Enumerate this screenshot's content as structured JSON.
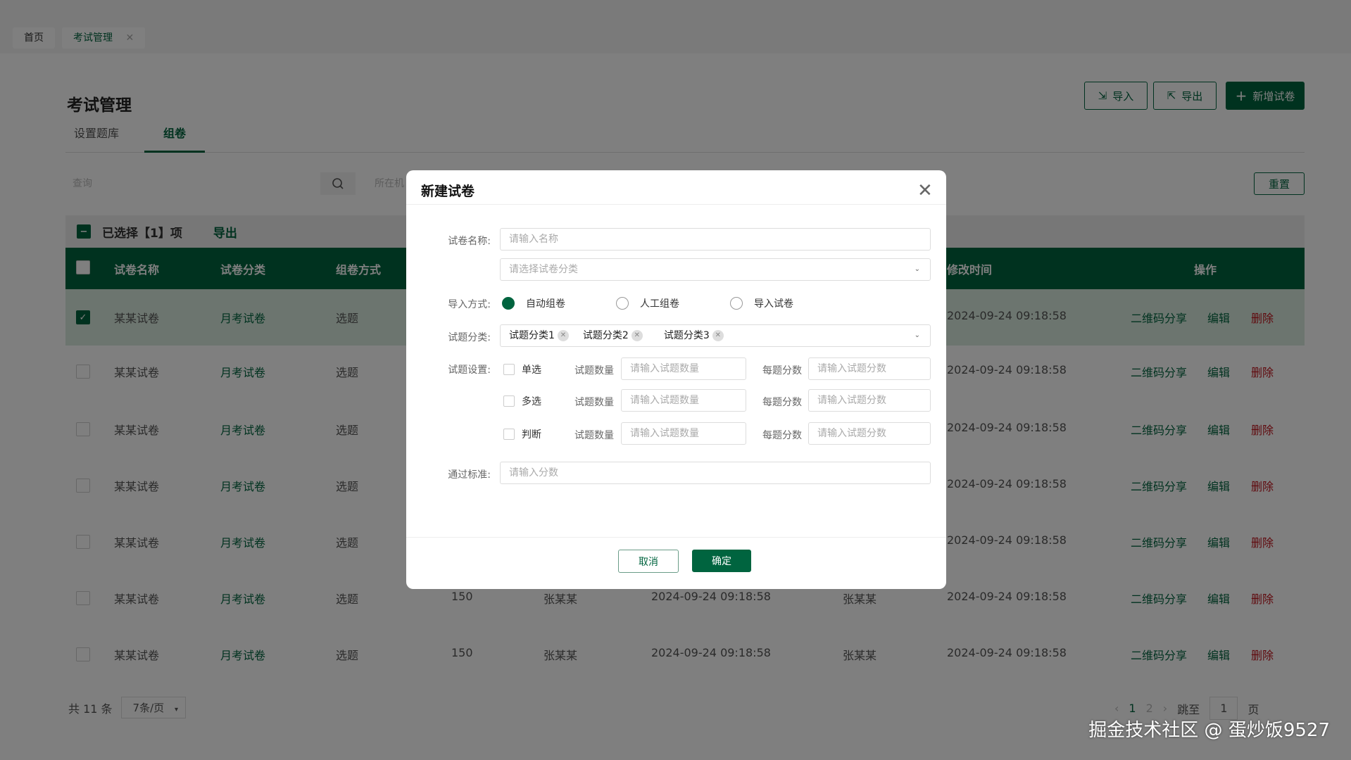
{
  "page_tabs": [
    {
      "label": "首页"
    },
    {
      "label": "考试管理",
      "close": "✕"
    }
  ],
  "title": "考试管理",
  "sub_tabs": [
    "设置题库",
    "组卷"
  ],
  "toolbar": {
    "import": "导入",
    "export": "导出",
    "add": "新增试卷",
    "reset": "重置"
  },
  "search": {
    "placeholder": "查询",
    "filter_placeholder": "所在机"
  },
  "selection": {
    "text": "已选择【1】项",
    "export": "导出"
  },
  "table": {
    "headers": {
      "name": "试卷名称",
      "category": "试卷分类",
      "method": "组卷方式",
      "modified": "修改时间",
      "actions": "操作"
    },
    "rows": [
      {
        "checked": true,
        "c": [
          "某某试卷",
          "月考试卷",
          "选题",
          "",
          "",
          "",
          "",
          "2024-09-24 09:18:58"
        ]
      },
      {
        "checked": false,
        "c": [
          "某某试卷",
          "月考试卷",
          "选题",
          "",
          "",
          "",
          "",
          "2024-09-24 09:18:58"
        ]
      },
      {
        "checked": false,
        "c": [
          "某某试卷",
          "月考试卷",
          "选题",
          "",
          "",
          "",
          "",
          "2024-09-24 09:18:58"
        ]
      },
      {
        "checked": false,
        "c": [
          "某某试卷",
          "月考试卷",
          "选题",
          "",
          "",
          "",
          "",
          "2024-09-24 09:18:58"
        ]
      },
      {
        "checked": false,
        "c": [
          "某某试卷",
          "月考试卷",
          "选题",
          "",
          "",
          "",
          "",
          "2024-09-24 09:18:58"
        ]
      },
      {
        "checked": false,
        "c": [
          "某某试卷",
          "月考试卷",
          "选题",
          "150",
          "张某某",
          "2024-09-24 09:18:58",
          "张某某",
          "2024-09-24 09:18:58"
        ]
      },
      {
        "checked": false,
        "c": [
          "某某试卷",
          "月考试卷",
          "选题",
          "150",
          "张某某",
          "2024-09-24 09:18:58",
          "张某某",
          "2024-09-24 09:18:58"
        ]
      }
    ],
    "actions": [
      "二维码分享",
      "编辑",
      "删除"
    ]
  },
  "pagination": {
    "total": "共 11 条",
    "page_size": "7条/页",
    "pages": [
      "1",
      "2"
    ],
    "goto": "跳至",
    "goto_value": "1",
    "page_suffix": "页"
  },
  "dialog": {
    "title": "新建试卷",
    "name_label": "试卷名称:",
    "name_placeholder": "请输入名称",
    "category_placeholder": "请选择试卷分类",
    "import_label": "导入方式:",
    "import_options": [
      "自动组卷",
      "人工组卷",
      "导入试卷"
    ],
    "qcat_label": "试题分类:",
    "qcat_tags": [
      "试题分类1",
      "试题分类2",
      "试题分类3"
    ],
    "settings_label": "试题设置:",
    "settings": [
      {
        "type": "单选"
      },
      {
        "type": "多选"
      },
      {
        "type": "判断"
      }
    ],
    "count_label": "试题数量",
    "count_placeholder": "请输入试题数量",
    "score_label": "每题分数",
    "score_placeholder": "请输入试题分数",
    "pass_label": "通过标准:",
    "pass_placeholder": "请输入分数",
    "cancel": "取消",
    "confirm": "确定"
  },
  "watermark": "掘金技术社区 @ 蛋炒饭9527",
  "colors": {
    "primary": "#00643f",
    "danger": "#c0141c"
  }
}
